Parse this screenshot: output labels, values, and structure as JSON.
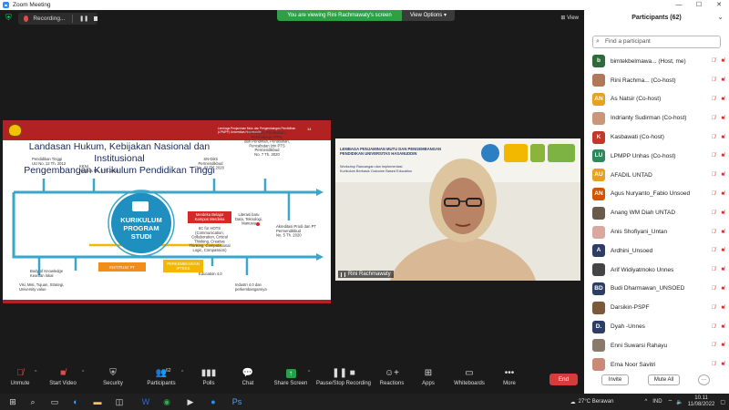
{
  "window": {
    "title": "Zoom Meeting",
    "controls": [
      "—",
      "☐",
      "✕"
    ]
  },
  "topbar": {
    "recording_label": "Recording...",
    "viewing_banner": "You are viewing Rini Rachmawaty's screen",
    "view_options": "View Options ▾",
    "view_label": "View"
  },
  "slide": {
    "header_text": "Lembaga Penjaminan Mutu dan Pengembangan Pendidikan (LPMPP) Universitas Hasanuddin",
    "page": "14",
    "title_line1": "Landasan Hukum, Kebijakan Nasional dan Institusional",
    "title_line2": "Pengembangan Kurikulum Pendidikan Tinggi",
    "center_lines": [
      "KURIKULUM",
      "PROGRAM",
      "STUDI"
    ],
    "labels": {
      "uu12": "Pendidikan Tinggi\nUU No. 12 Th. 2012",
      "kkni": "KKNI\nPerpres No. 8 Th. 2012",
      "sndikti": "SN-Dikti\nPermendikbud\nNo. 03 Th. 2020",
      "pendirian": "Pendirian, Perubahan,\nPembubaran PTN,\ndan Pendirian, Perubahan,\nPencabutan Izin PTS\nPermendikbud\nNo. 7 Th. 2020",
      "merdeka": "Merdeka Belajar\nKampus Merdeka",
      "sixc": "6C for HOTS\n(Communication,\nCollaboration, Critical\nThinking, Creative\nThinking, Computational\nLogic, Compassion)",
      "literasi": "Literasi baru\nData, Teknologi,\nManusia",
      "akreditasi": "Akreditasi Prodi dan PT\nPermendikbud\nNo. 5 Th. 2020",
      "institusi": "INSTITUSI/ PT",
      "ipteks": "PERKEMBANGAN\nIPTEKS",
      "body": "Body of Knowledge\nKearifan lokal",
      "visi": "Visi, Misi, Tujuan, Strategi,\nUniversity value",
      "edu": "Education 4.0",
      "industri": "Industri 4.0 dan\nperkembangannya"
    }
  },
  "camera": {
    "banner_line1": "LEMBAGA PENJAMINAN MUTU DAN PENGEMBANGAN",
    "banner_line2": "PENDIDIKAN UNIVERSITAS HASANUDDIN",
    "workshop_line1": "Workshop Rancangan dan Implementasi",
    "workshop_line2": "Kurikulum Berbasis Outcome Based Education",
    "logo1": "Kampus Merdeka",
    "logo2": "ASIIN",
    "name": "Rini Rachmawaty"
  },
  "toolbar": {
    "unmute": "Unmute",
    "start_video": "Start Video",
    "security": "Security",
    "participants": "Participants",
    "participants_count": "62",
    "polls": "Polls",
    "chat": "Chat",
    "share_screen": "Share Screen",
    "pause_recording": "Pause/Stop Recording",
    "reactions": "Reactions",
    "apps": "Apps",
    "whiteboards": "Whiteboards",
    "more": "More",
    "end": "End"
  },
  "panel": {
    "title": "Participants (62)",
    "search_placeholder": "Find a participant",
    "invite": "Invite",
    "mute_all": "Mute All",
    "more": "···",
    "participants": [
      {
        "initials": "b",
        "name": "bimtekbelmawa... (Host, me)",
        "color": "#2f6b3a"
      },
      {
        "initials": "",
        "name": "Rini Rachma... (Co-host)",
        "color": "#b07a5a"
      },
      {
        "initials": "AN",
        "name": "As Natsir (Co-host)",
        "color": "#e8a020"
      },
      {
        "initials": "",
        "name": "Indrianty Sudirman (Co-host)",
        "color": "#c9967a"
      },
      {
        "initials": "K",
        "name": "Kasbawati (Co-host)",
        "color": "#c0392b"
      },
      {
        "initials": "LU",
        "name": "LPMPP Unhas (Co-host)",
        "color": "#2d8a5a"
      },
      {
        "initials": "AU",
        "name": "AFADIL UNTAD",
        "color": "#e8a020"
      },
      {
        "initials": "AN",
        "name": "Agus Nuryanto_Fabio Unsoed",
        "color": "#d35400"
      },
      {
        "initials": "",
        "name": "Anang WM Diah UNTAD",
        "color": "#6a5a4a"
      },
      {
        "initials": "",
        "name": "Anis Shofiyani_Untan",
        "color": "#d9a9a0"
      },
      {
        "initials": "A",
        "name": "Ardhini_Unsoed",
        "color": "#2c3e66"
      },
      {
        "initials": "",
        "name": "Arif Widiyatmoko Unnes",
        "color": "#444"
      },
      {
        "initials": "BD",
        "name": "Budi Dharmawan_UNSOED",
        "color": "#2c3e66"
      },
      {
        "initials": "",
        "name": "Darsikin-PSPF",
        "color": "#7a5a3a"
      },
      {
        "initials": "D.",
        "name": "Dyah -Unnes",
        "color": "#2c3e66"
      },
      {
        "initials": "",
        "name": "Enni Suwarsi Rahayu",
        "color": "#8a7a6a"
      },
      {
        "initials": "",
        "name": "Erna Noor Savitri",
        "color": "#c98a7a"
      }
    ]
  },
  "taskbar": {
    "weather": "27°C  Berawan",
    "lang": "IND",
    "time": "10.11",
    "date": "11/08/2022"
  }
}
